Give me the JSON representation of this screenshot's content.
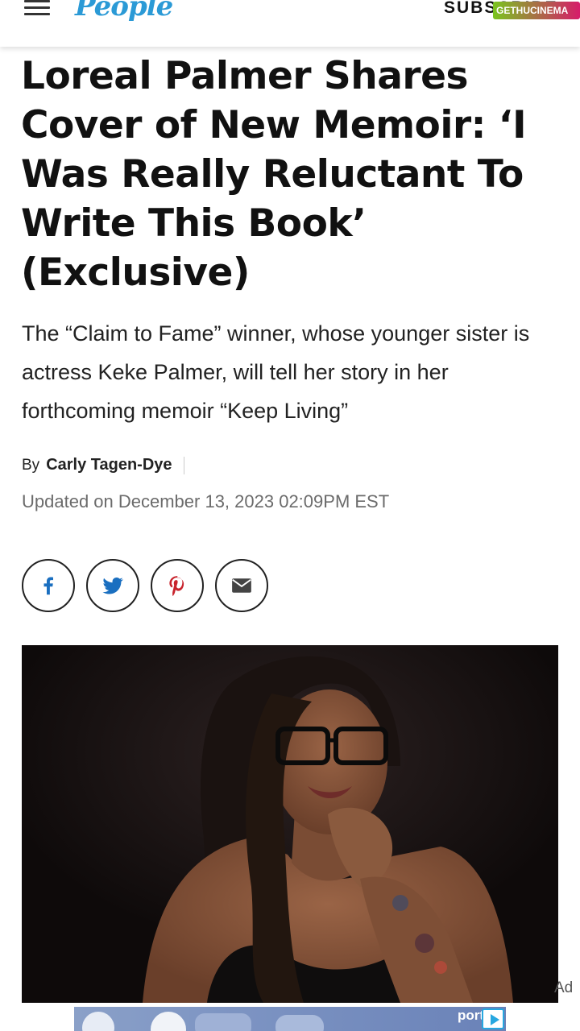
{
  "header": {
    "menu_icon": "hamburger-menu-icon",
    "logo": "People",
    "subscribe": "SUBSCRIBE",
    "watermark": "GETHUCINEMA"
  },
  "article": {
    "headline": "Loreal Palmer Shares Cover of New Memoir: ‘I Was Really Reluctant To Write This Book’ (Exclusive)",
    "dek": "The “Claim to Fame” winner, whose younger sister is actress Keke Palmer, will tell her story in her forthcoming memoir “Keep Living”",
    "by_label": "By",
    "author": "Carly Tagen-Dye",
    "updated": "Updated on December 13, 2023 02:09PM EST"
  },
  "share": [
    {
      "icon": "facebook-icon"
    },
    {
      "icon": "twitter-icon"
    },
    {
      "icon": "pinterest-icon"
    },
    {
      "icon": "email-icon"
    }
  ],
  "photo": {
    "subject": "photo of Loreal Palmer"
  },
  "ad": {
    "label": "Ad",
    "brand": "port"
  },
  "colors": {
    "logo_blue": "#2b9ad6",
    "share_icon_blue": "#1a6fc0",
    "pinterest_red": "#c8232c",
    "text_gray": "#6b6b6b"
  }
}
